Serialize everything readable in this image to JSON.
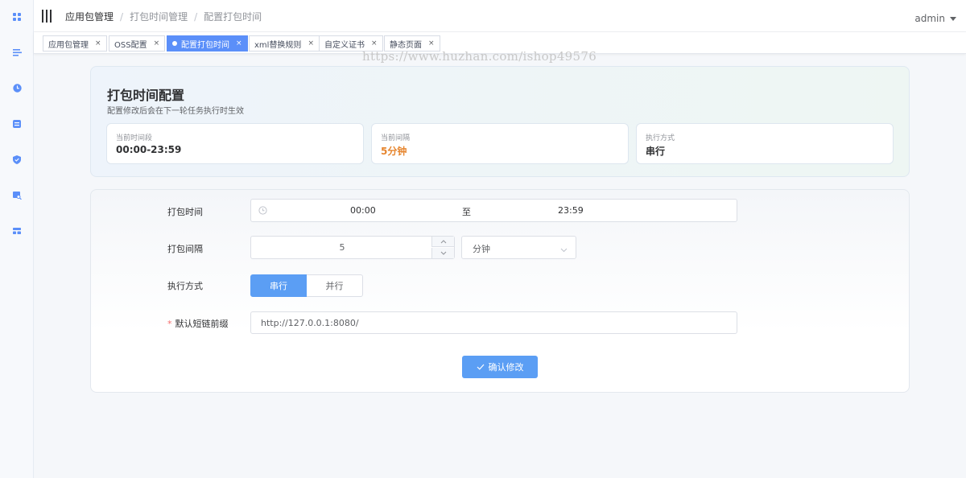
{
  "sidebar": {
    "icons": [
      "dashboard-icon",
      "list-icon",
      "clock-icon",
      "package-icon",
      "shield-icon",
      "search-doc-icon",
      "layout-icon"
    ]
  },
  "header": {
    "breadcrumb": [
      "应用包管理",
      "打包时间管理",
      "配置打包时间"
    ],
    "separator": "/",
    "user": "admin"
  },
  "tags": [
    {
      "label": "应用包管理",
      "active": false
    },
    {
      "label": "OSS配置",
      "active": false
    },
    {
      "label": "配置打包时间",
      "active": true
    },
    {
      "label": "xml替换规则",
      "active": false
    },
    {
      "label": "自定义证书",
      "active": false
    },
    {
      "label": "静态页面",
      "active": false
    }
  ],
  "tag_close": "×",
  "watermark": "https://www.huzhan.com/ishop49576",
  "summary": {
    "title": "打包时间配置",
    "subtitle": "配置修改后会在下一轮任务执行时生效",
    "stats": [
      {
        "label": "当前时间段",
        "value": "00:00-23:59"
      },
      {
        "label": "当前间隔",
        "value": "5分钟"
      },
      {
        "label": "执行方式",
        "value": "串行"
      }
    ]
  },
  "form": {
    "time_label": "打包时间",
    "time_start": "00:00",
    "time_sep": "至",
    "time_end": "23:59",
    "interval_label": "打包间隔",
    "interval_value": "5",
    "interval_unit": "分钟",
    "mode_label": "执行方式",
    "mode_options": [
      "串行",
      "并行"
    ],
    "mode_selected": "串行",
    "prefix_required": "*",
    "prefix_label": "默认短链前缀",
    "prefix_value": "http://127.0.0.1:8080/",
    "submit_label": "确认修改"
  },
  "colors": {
    "primary": "#5b9ef4",
    "tag_active": "#5b8ff9",
    "accent_orange": "#e6852e",
    "required": "#f56c6c"
  }
}
